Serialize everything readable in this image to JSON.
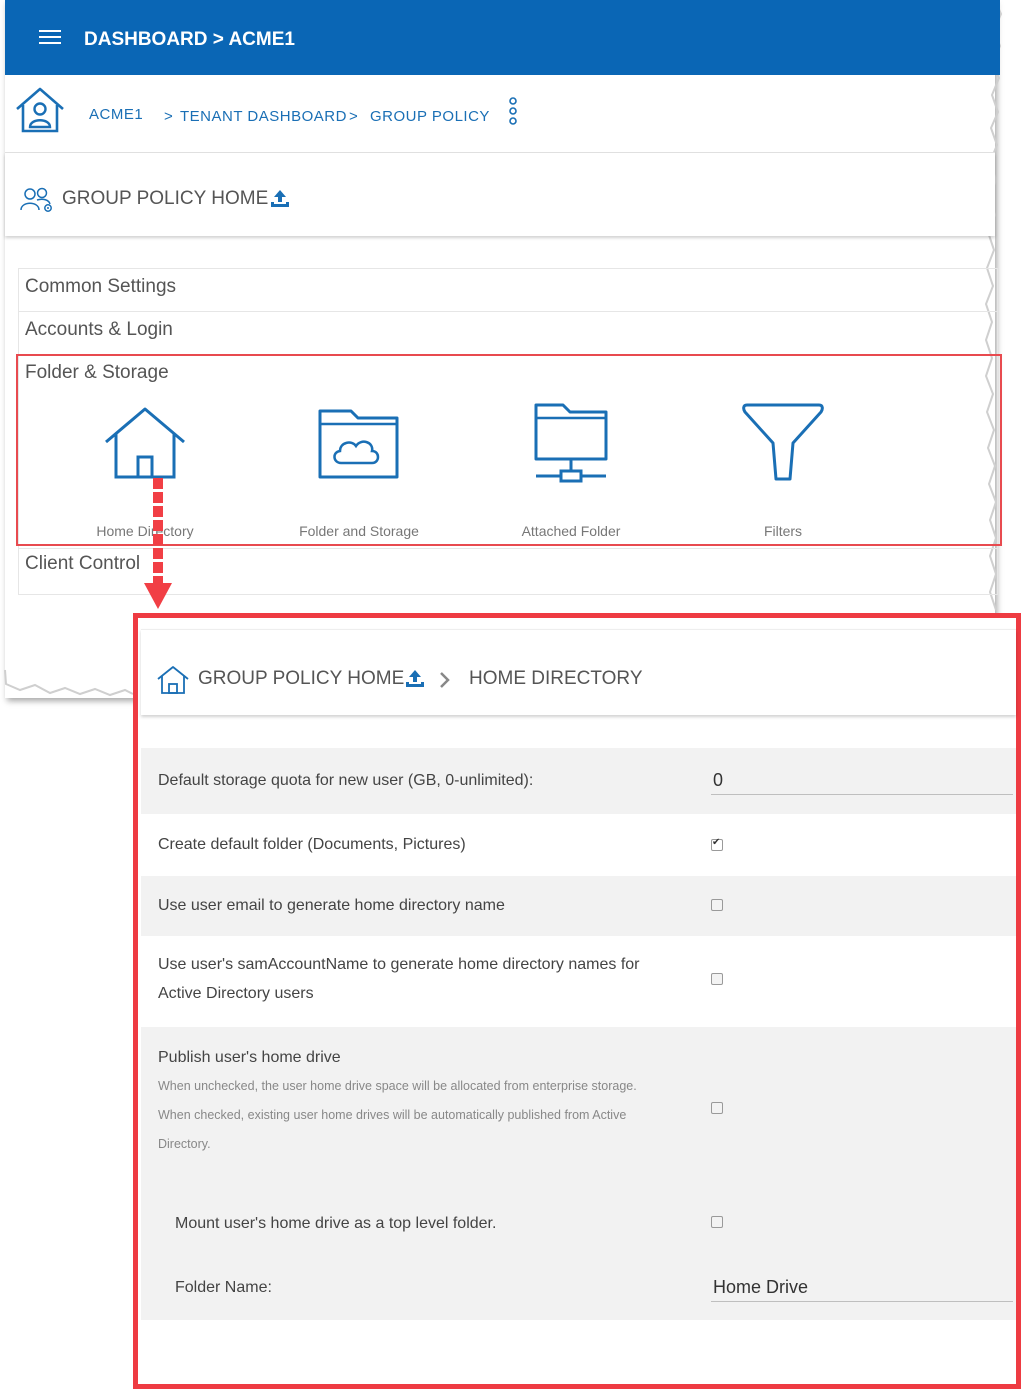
{
  "topbar": {
    "title": "DASHBOARD > ACME1"
  },
  "breadcrumb": {
    "items": [
      "ACME1",
      "TENANT DASHBOARD",
      "GROUP POLICY"
    ],
    "separator": ">"
  },
  "group_policy": {
    "title": "GROUP POLICY HOME"
  },
  "sections": [
    {
      "label": "Common Settings"
    },
    {
      "label": "Accounts & Login"
    },
    {
      "label": "Folder & Storage"
    },
    {
      "label": "Client Control"
    }
  ],
  "folder_storage_icons": [
    {
      "label": "Home Directory",
      "icon": "home-icon"
    },
    {
      "label": "Folder and Storage",
      "icon": "cloud-folder-icon"
    },
    {
      "label": "Attached Folder",
      "icon": "network-folder-icon"
    },
    {
      "label": "Filters",
      "icon": "filter-icon"
    }
  ],
  "detail": {
    "breadcrumb_home": "GROUP POLICY HOME",
    "breadcrumb_current": "HOME DIRECTORY",
    "storage_quota": {
      "label": "Default storage quota for new user (GB, 0-unlimited):",
      "value": "0"
    },
    "create_default_folder": {
      "label": "Create default folder (Documents, Pictures)",
      "checked": true
    },
    "use_email": {
      "label": "Use user email to generate home directory name",
      "checked": false
    },
    "use_sam": {
      "label_line1": "Use user's samAccountName to generate home directory names for",
      "label_line2": "Active Directory users",
      "checked": false
    },
    "publish_home": {
      "label": "Publish user's home drive",
      "help_line1": "When unchecked, the user home drive space will be allocated from enterprise storage.",
      "help_line2": "When checked, existing user home drives will be automatically published from Active",
      "help_line3": "Directory.",
      "checked": false
    },
    "mount_top_level": {
      "label": "Mount user's home drive as a top level folder.",
      "checked": false
    },
    "folder_name": {
      "label": "Folder Name:",
      "value": "Home Drive"
    }
  },
  "colors": {
    "brand_blue": "#0a66b5",
    "link_blue": "#1a6fb5",
    "highlight_red": "#ee3b42"
  }
}
